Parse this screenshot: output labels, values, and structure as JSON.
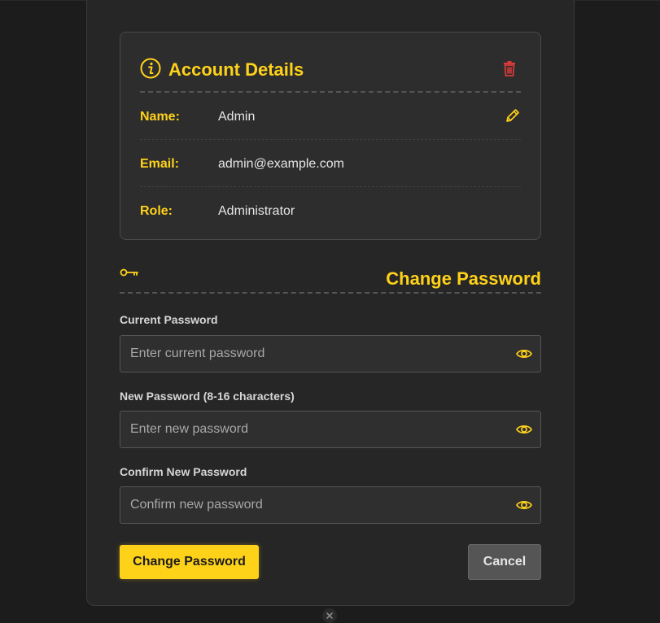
{
  "colors": {
    "accent": "#ffd21a",
    "danger": "#d83a3a",
    "background": "#1c1c1c",
    "panel": "#262626"
  },
  "account": {
    "title": "Account Details",
    "title_icon": "info-icon",
    "delete_icon": "trash-icon",
    "edit_icon": "pencil-icon",
    "rows": [
      {
        "label": "Name:",
        "value": "Admin"
      },
      {
        "label": "Email:",
        "value": "admin@example.com"
      },
      {
        "label": "Role:",
        "value": "Administrator"
      }
    ]
  },
  "change_password": {
    "title": "Change Password",
    "icon": "key-icon",
    "fields": [
      {
        "label": "Current Password",
        "placeholder": "Enter current password",
        "value": ""
      },
      {
        "label": "New Password (8-16 characters)",
        "placeholder": "Enter new password",
        "value": ""
      },
      {
        "label": "Confirm New Password",
        "placeholder": "Confirm new password",
        "value": ""
      }
    ],
    "submit_label": "Change Password",
    "cancel_label": "Cancel"
  }
}
